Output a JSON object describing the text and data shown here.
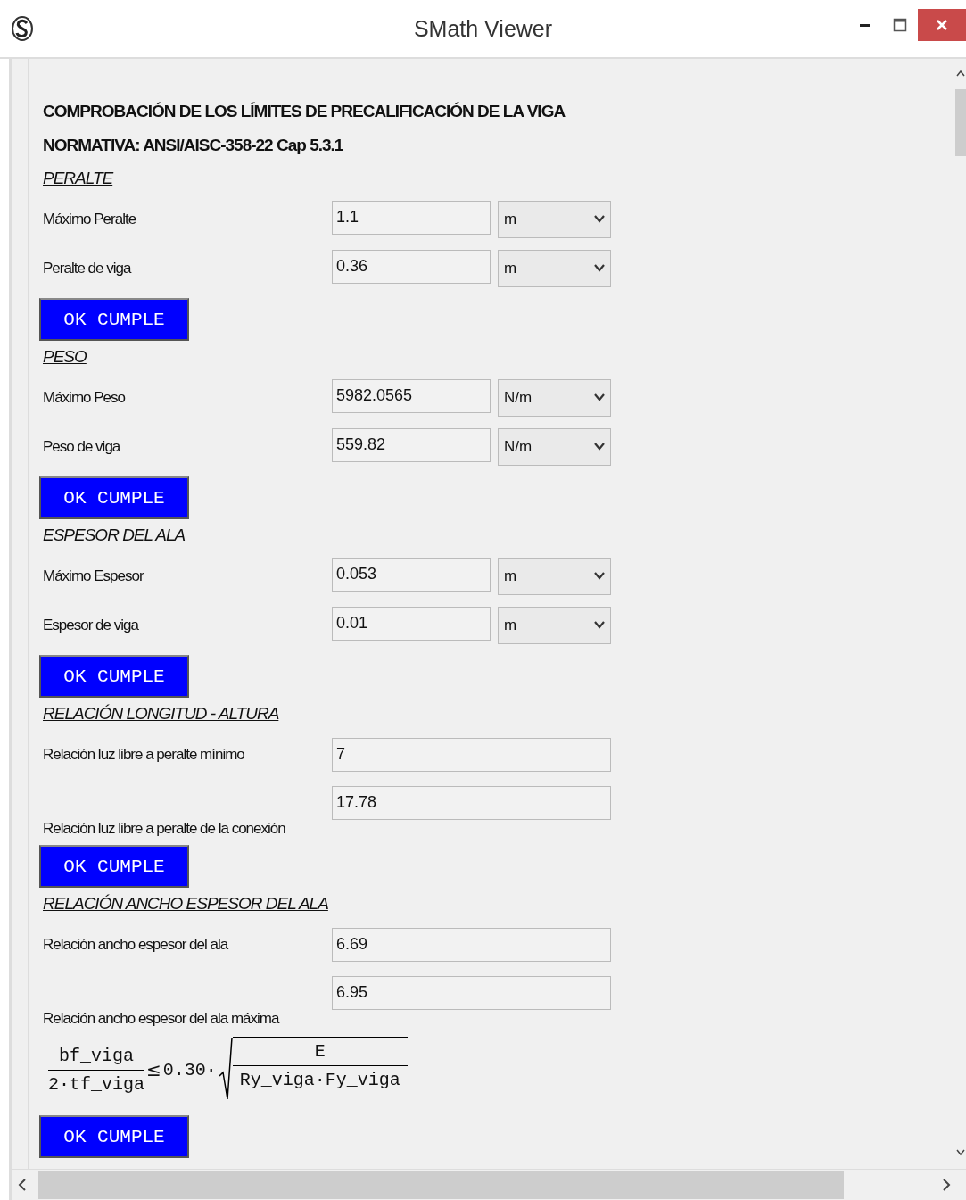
{
  "window": {
    "title": "SMath Viewer"
  },
  "heading": [
    "COMPROBACIÓN DE LOS LÍMITES DE PRECALIFICACIÓN DE LA VIGA",
    "NORMATIVA: ANSI/AISC-358-22 Cap 5.3.1"
  ],
  "sections": [
    {
      "title": "PERALTE",
      "rows": [
        {
          "label": "Máximo Peralte",
          "value": "1.1",
          "unit": "m"
        },
        {
          "label": "Peralte de viga",
          "value": "0.36",
          "unit": "m"
        }
      ],
      "status": "OK CUMPLE"
    },
    {
      "title": "PESO",
      "rows": [
        {
          "label": "Máximo Peso",
          "value": "5982.0565",
          "unit": "N/m"
        },
        {
          "label": "Peso de viga",
          "value": "559.82",
          "unit": "N/m"
        }
      ],
      "status": "OK CUMPLE"
    },
    {
      "title": "ESPESOR DEL ALA",
      "rows": [
        {
          "label": "Máximo Espesor",
          "value": "0.053",
          "unit": "m"
        },
        {
          "label": "Espesor de viga",
          "value": "0.01",
          "unit": "m"
        }
      ],
      "status": "OK CUMPLE"
    },
    {
      "title": "RELACIÓN LONGITUD - ALTURA",
      "rows": [
        {
          "label": "Relación luz libre a peralte mínimo",
          "value": "7"
        },
        {
          "label": "Relación luz libre a peralte de la conexión",
          "value": "17.78"
        }
      ],
      "status": "OK CUMPLE"
    },
    {
      "title": "RELACIÓN ANCHO ESPESOR DEL ALA",
      "rows": [
        {
          "label": "Relación ancho espesor del ala",
          "value": "6.69"
        },
        {
          "label": "Relación ancho espesor del ala máxima",
          "value": "6.95"
        }
      ],
      "formula": {
        "numerator": "bf_viga",
        "denominator": "2·tf_viga",
        "relation": "≤",
        "coefficient": "0.30·",
        "root_numerator": "E",
        "root_denominator": "Ry_viga·Fy_viga"
      },
      "status": "OK CUMPLE"
    }
  ]
}
